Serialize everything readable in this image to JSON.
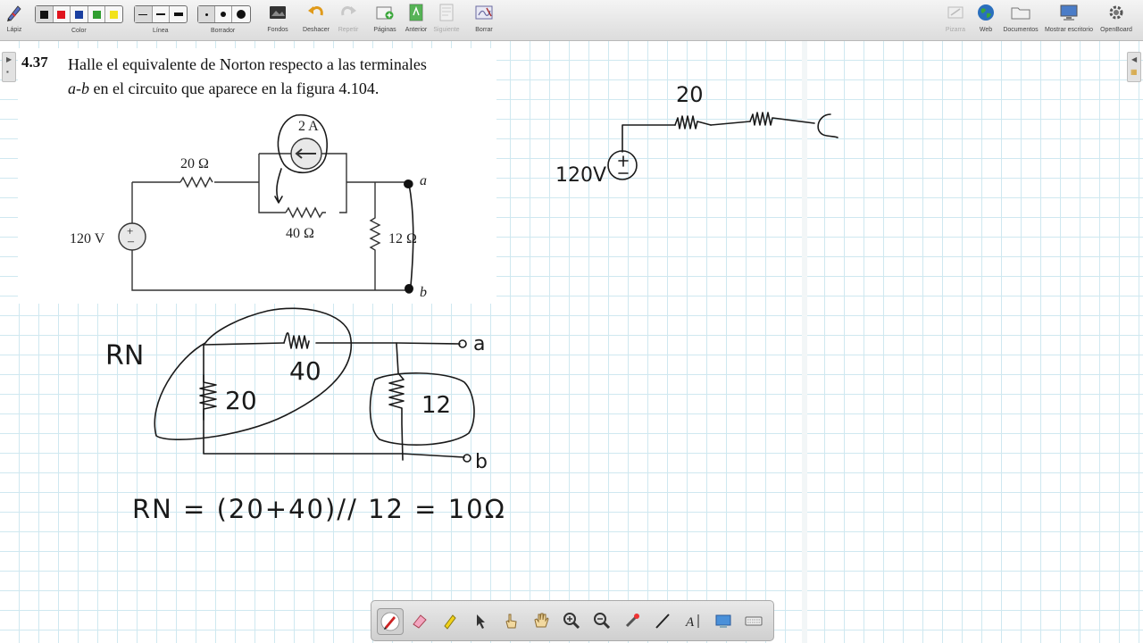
{
  "toolbar": {
    "pen_label": "Lápiz",
    "color_label": "Color",
    "line_label": "Línea",
    "eraser_label": "Borrador",
    "backgrounds_label": "Fondos",
    "undo_label": "Deshacer",
    "redo_label": "Repetir",
    "pages_label": "Páginas",
    "previous_label": "Anterior",
    "next_label": "Siguiente",
    "erase_label": "Borrar",
    "board_label": "Pizarra",
    "web_label": "Web",
    "documents_label": "Documentos",
    "show_desktop_label": "Mostrar escritorio",
    "openboard_label": "OpenBoard",
    "colors": [
      "#111111",
      "#e0141e",
      "#1a3fa0",
      "#2f9e2f",
      "#f2e21a"
    ]
  },
  "problem": {
    "number": "4.37",
    "line1": "Halle el equivalente de Norton respecto a las terminales",
    "terminals": "a-b",
    "line2_rest": " en el circuito que aparece en la figura 4.104."
  },
  "figure": {
    "source_label": "120 V",
    "r1_label": "20 Ω",
    "current_label": "2 A",
    "r2_label": "40 Ω",
    "r3_label": "12 Ω",
    "term_a": "a",
    "term_b": "b"
  },
  "handwriting": {
    "rn_label": "RN",
    "r20": "20",
    "r40": "40",
    "r12": "12",
    "term_a": "a",
    "term_b": "b",
    "equation": "RN = (20+40)// 12 = 10Ω",
    "right_r20": "20",
    "right_source": "120V"
  },
  "dock": {
    "tools": [
      "pen",
      "eraser",
      "highlighter",
      "pointer",
      "hand-pointer",
      "pan",
      "zoom-in",
      "zoom-out",
      "laser",
      "line",
      "text",
      "capture",
      "keyboard"
    ]
  }
}
